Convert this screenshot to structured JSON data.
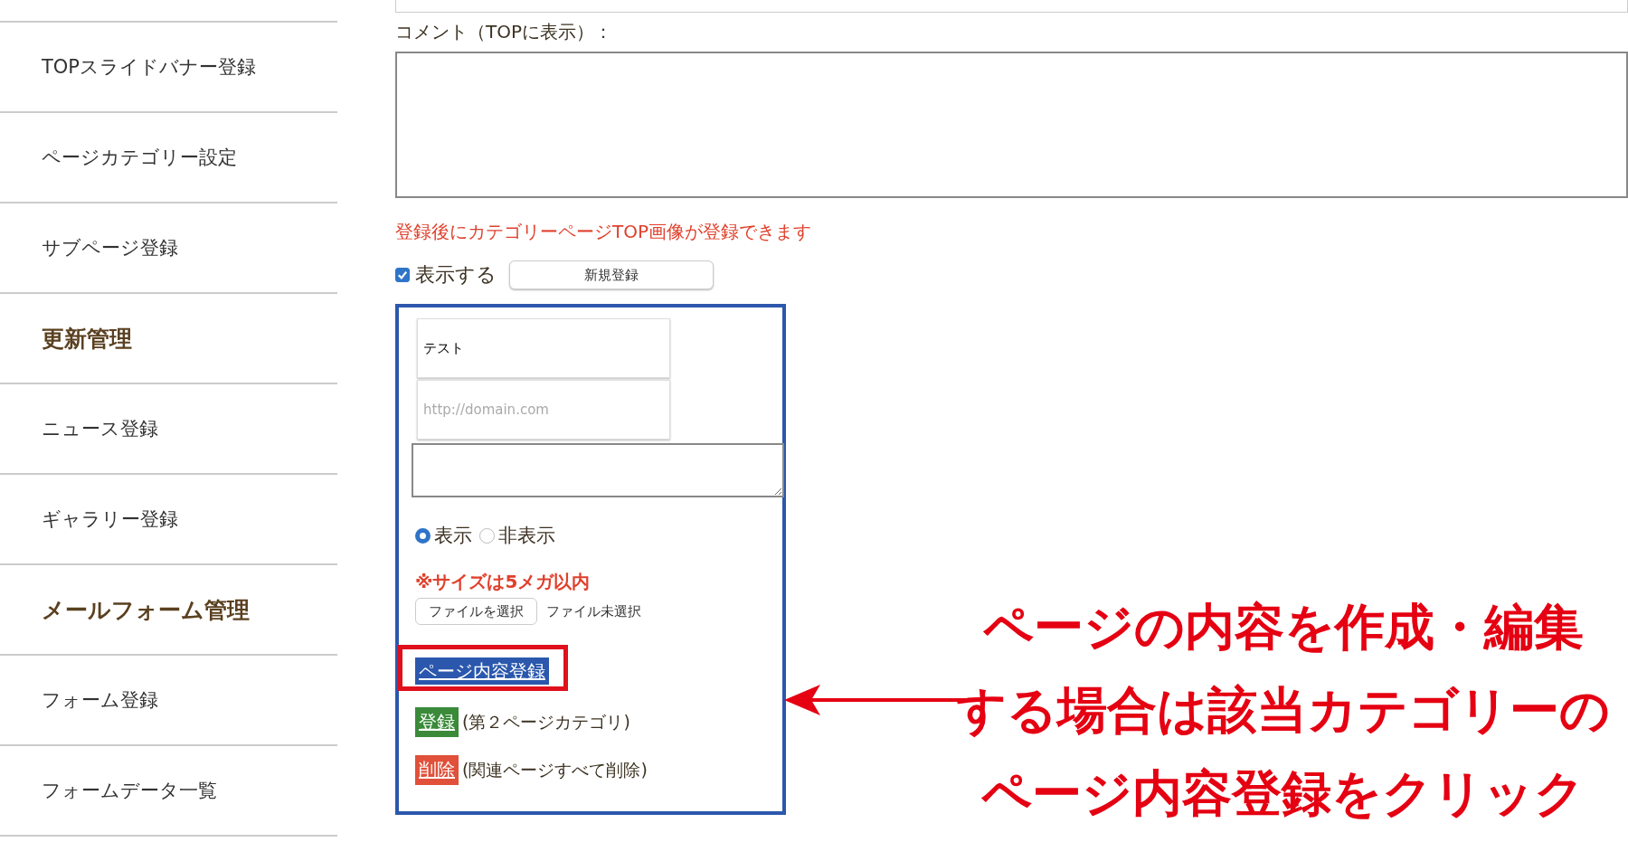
{
  "sidebar": {
    "items": [
      {
        "kind": "link",
        "label": "TOPスライドバナー登録"
      },
      {
        "kind": "link",
        "label": "ページカテゴリー設定"
      },
      {
        "kind": "link",
        "label": "サブページ登録"
      },
      {
        "kind": "heading",
        "label": "更新管理"
      },
      {
        "kind": "link",
        "label": "ニュース登録"
      },
      {
        "kind": "link",
        "label": "ギャラリー登録"
      },
      {
        "kind": "heading",
        "label": "メールフォーム管理"
      },
      {
        "kind": "link",
        "label": "フォーム登録"
      },
      {
        "kind": "link",
        "label": "フォームデータ一覧"
      }
    ]
  },
  "form": {
    "comment_label": "コメント（TOPに表示）：",
    "note": "登録後にカテゴリーページTOP画像が登録できます",
    "show_checkbox": {
      "label": "表示する",
      "checked": true
    },
    "new_button": "新規登録"
  },
  "category": {
    "name_value": "テスト",
    "url_placeholder": "http://domain.com",
    "visibility": [
      {
        "label": "表示",
        "selected": true
      },
      {
        "label": "非表示",
        "selected": false
      }
    ],
    "size_note": "※サイズは5メガ以内",
    "file_button": "ファイルを選択",
    "file_status": "ファイル未選択",
    "actions": [
      {
        "kind": "content",
        "label": "ページ内容登録",
        "highlighted": true
      },
      {
        "kind": "register",
        "label": "登録",
        "note": "(第２ページカテゴリ)"
      },
      {
        "kind": "delete",
        "label": "削除",
        "note": "(関連ページすべて削除)"
      }
    ]
  },
  "annotation": {
    "lines": [
      "ページの内容を作成・編集",
      "する場合は該当カテゴリーの",
      "ページ内容登録をクリック"
    ]
  }
}
